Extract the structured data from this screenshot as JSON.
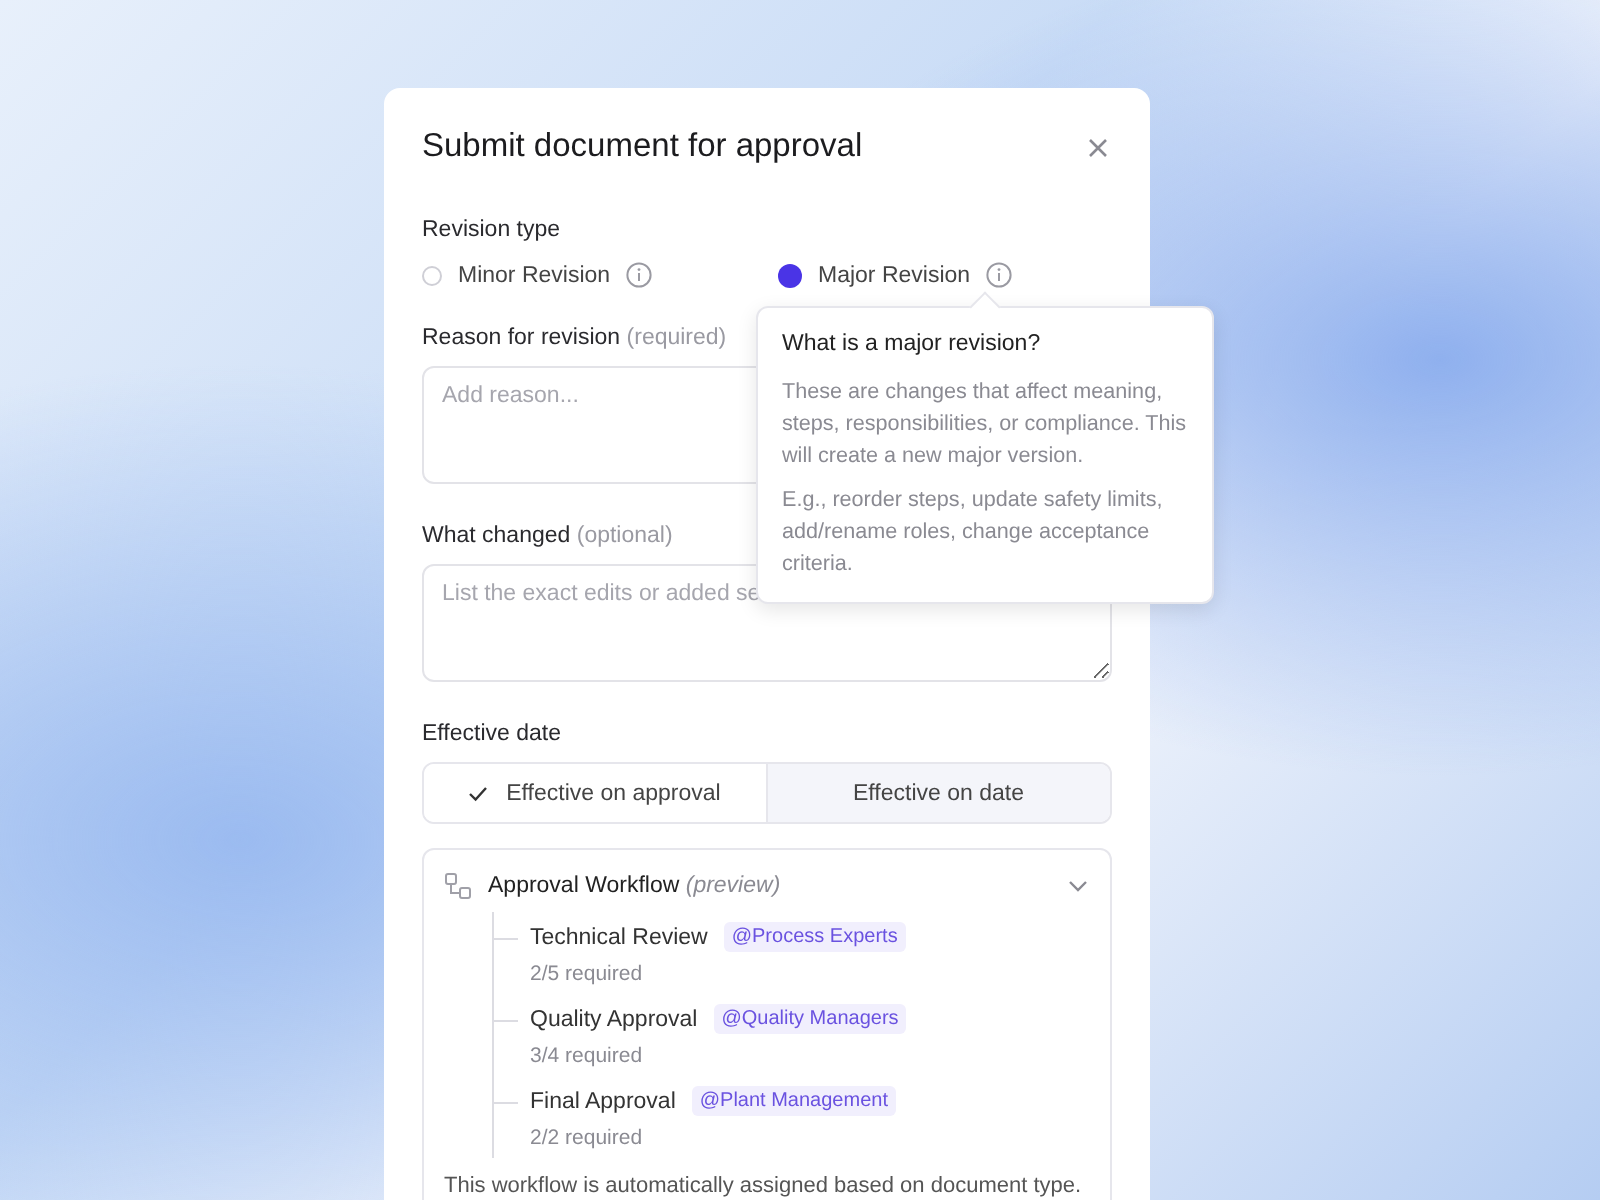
{
  "dialog": {
    "title": "Submit document for approval"
  },
  "revision_type": {
    "label": "Revision type",
    "options": [
      {
        "label": "Minor Revision",
        "selected": false
      },
      {
        "label": "Major Revision",
        "selected": true
      }
    ]
  },
  "tooltip": {
    "title": "What is a major revision?",
    "paragraphs": [
      "These are changes that affect meaning, steps, responsibilities, or compliance. This will create a new major version.",
      "E.g., reorder steps, update safety limits, add/rename roles, change acceptance criteria."
    ]
  },
  "reason": {
    "label": "Reason for revision",
    "hint": "(required)",
    "placeholder": "Add reason..."
  },
  "what_changed": {
    "label": "What changed",
    "hint": "(optional)",
    "placeholder": "List the exact edits or added se"
  },
  "effective_date": {
    "label": "Effective date",
    "options": [
      {
        "label": "Effective on approval",
        "selected": true
      },
      {
        "label": "Effective on date",
        "selected": false
      }
    ]
  },
  "workflow": {
    "title": "Approval Workflow",
    "note": "(preview)",
    "expanded": true,
    "steps": [
      {
        "name": "Technical Review",
        "group": "@Process Experts",
        "required": "2/5 required"
      },
      {
        "name": "Quality Approval",
        "group": "@Quality Managers",
        "required": "3/4 required"
      },
      {
        "name": "Final Approval",
        "group": "@Plant Management",
        "required": "2/2 required"
      }
    ],
    "footer": "This workflow is automatically assigned based on document type."
  }
}
